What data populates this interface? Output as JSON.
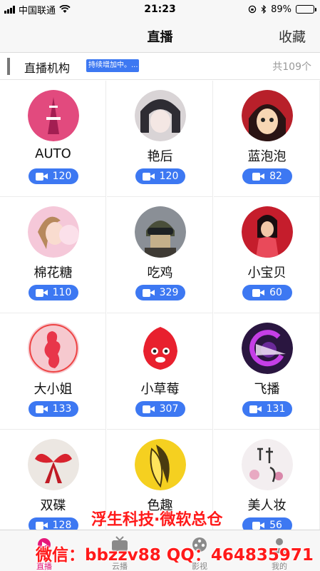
{
  "status_bar": {
    "carrier": "中国联通",
    "time": "21:23",
    "battery": "89%",
    "battery_level": 0.89
  },
  "nav": {
    "title": "直播",
    "favorite": "收藏"
  },
  "section": {
    "title": "直播机构",
    "badge": "持续增加中。...",
    "count": "共109个"
  },
  "platforms": [
    {
      "name": "AUTO",
      "count": "120"
    },
    {
      "name": "艳后",
      "count": "120"
    },
    {
      "name": "蓝泡泡",
      "count": "82"
    },
    {
      "name": "棉花糖",
      "count": "110"
    },
    {
      "name": "吃鸡",
      "count": "329"
    },
    {
      "name": "小宝贝",
      "count": "60"
    },
    {
      "name": "大小姐",
      "count": "133"
    },
    {
      "name": "小草莓",
      "count": "307"
    },
    {
      "name": "飞播",
      "count": "131"
    },
    {
      "name": "双碟",
      "count": "128"
    },
    {
      "name": "色趣",
      "count": ""
    },
    {
      "name": "美人妆",
      "count": "56"
    }
  ],
  "tabs": [
    {
      "label": "直播",
      "icon": "live-tab-icon",
      "active": true
    },
    {
      "label": "云播",
      "icon": "tv-tab-icon",
      "active": false
    },
    {
      "label": "影视",
      "icon": "film-tab-icon",
      "active": false
    },
    {
      "label": "我的",
      "icon": "profile-tab-icon",
      "active": false
    }
  ],
  "watermark": {
    "line1": "浮生科技·微软总仓",
    "line2": "微信：bbzzv88   QQ：464835971"
  },
  "colors": {
    "accent": "#3d78f2",
    "active_tab": "#e5177a",
    "watermark": "#ff1a1a"
  }
}
